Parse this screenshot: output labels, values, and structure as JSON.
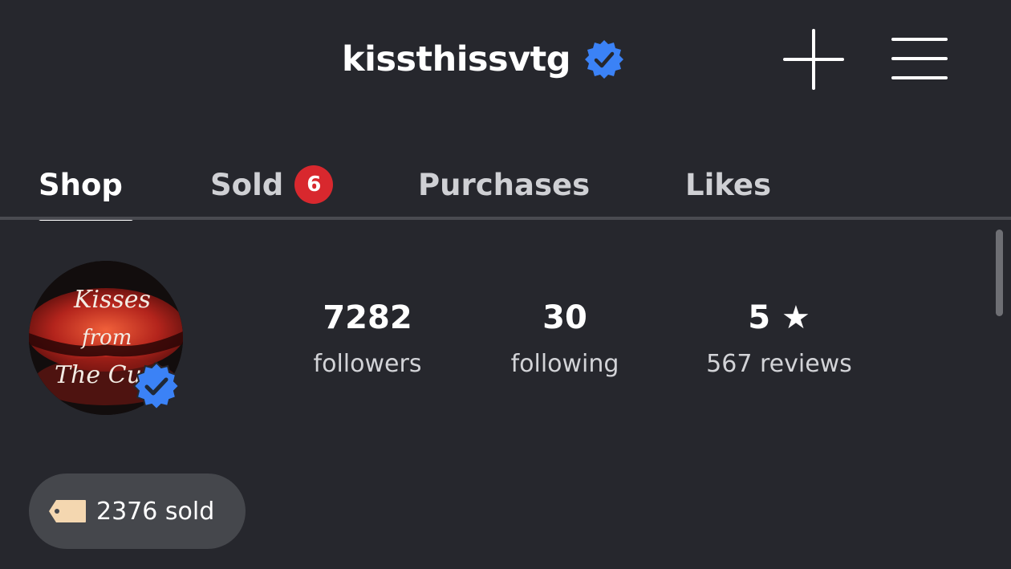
{
  "header": {
    "username": "kissthissvtg",
    "verified_icon": "verified-badge-icon",
    "add_icon": "plus-icon",
    "menu_icon": "hamburger-menu-icon"
  },
  "tabs": [
    {
      "label": "Shop",
      "active": true
    },
    {
      "label": "Sold",
      "badge": "6"
    },
    {
      "label": "Purchases"
    },
    {
      "label": "Likes"
    }
  ],
  "profile": {
    "avatar_text": [
      "Kisses",
      "from",
      "The Cu"
    ],
    "stats": {
      "followers": {
        "value": "7282",
        "label": "followers"
      },
      "following": {
        "value": "30",
        "label": "following"
      },
      "rating": {
        "value": "5 ★",
        "label": "567 reviews"
      }
    },
    "sold_chip": {
      "label": "2376 sold",
      "icon": "price-tag-icon"
    }
  },
  "colors": {
    "background": "#26272d",
    "verified_blue": "#3b82f6",
    "badge_red": "#d8282e",
    "chip_bg": "#45474c",
    "tag_fill": "#f4d7b0"
  }
}
